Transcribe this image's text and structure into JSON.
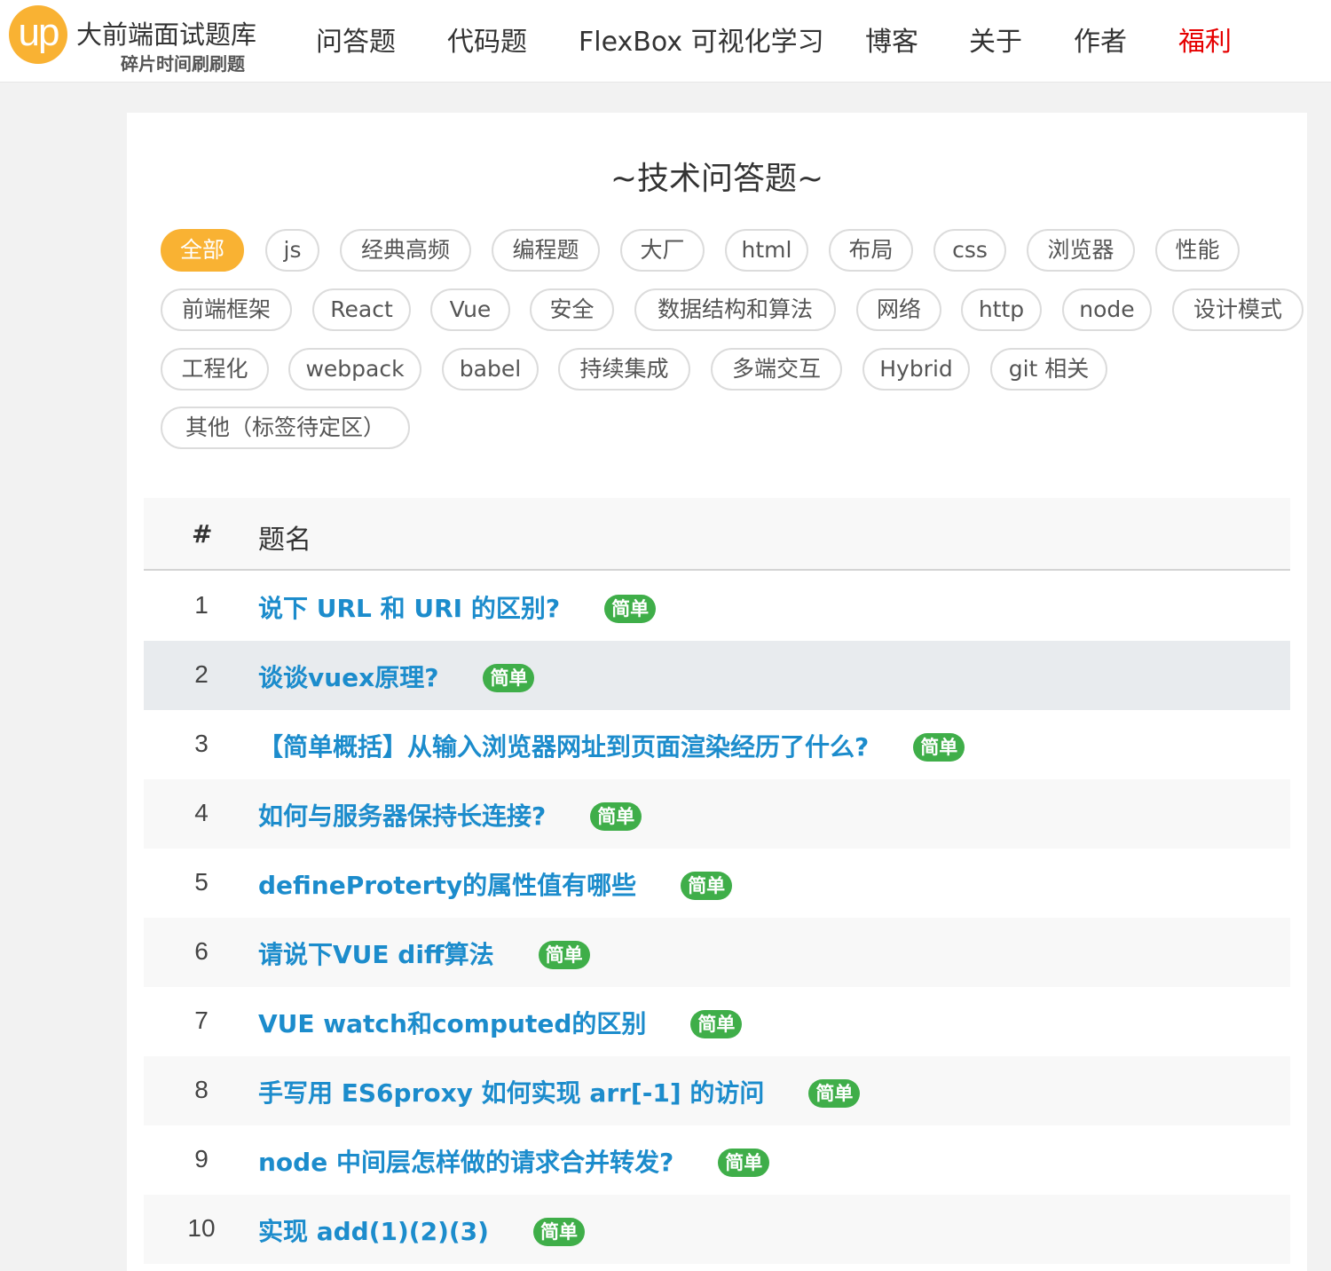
{
  "header": {
    "logo_text": "up",
    "site_name": "大前端面试题库",
    "slogan": "碎片时间刷刷题",
    "nav": [
      {
        "label": "问答题"
      },
      {
        "label": "代码题"
      },
      {
        "label": "FlexBox 可视化学习"
      },
      {
        "label": "博客"
      },
      {
        "label": "关于"
      },
      {
        "label": "作者"
      },
      {
        "label": "福利",
        "color": "#e60000"
      }
    ]
  },
  "main": {
    "title": "~技术问答题~",
    "active_tag": "全部",
    "tags": [
      "全部",
      "js",
      "经典高频",
      "编程题",
      "大厂",
      "html",
      "布局",
      "css",
      "浏览器",
      "性能",
      "前端框架",
      "React",
      "Vue",
      "安全",
      "数据结构和算法",
      "网络",
      "http",
      "node",
      "设计模式",
      "工程化",
      "webpack",
      "babel",
      "持续集成",
      "多端交互",
      "Hybrid",
      "git 相关",
      "其他（标签待定区）"
    ],
    "table": {
      "col_num": "#",
      "col_name": "题名",
      "rows": [
        {
          "num": "1",
          "title": "说下 URL 和 URI 的区别?",
          "badge": "简单"
        },
        {
          "num": "2",
          "title": "谈谈vuex原理?",
          "badge": "简单"
        },
        {
          "num": "3",
          "title": "【简单概括】从输入浏览器网址到页面渲染经历了什么?",
          "badge": "简单"
        },
        {
          "num": "4",
          "title": "如何与服务器保持长连接?",
          "badge": "简单"
        },
        {
          "num": "5",
          "title": "defineProterty的属性值有哪些",
          "badge": "简单"
        },
        {
          "num": "6",
          "title": "请说下VUE diff算法",
          "badge": "简单"
        },
        {
          "num": "7",
          "title": "VUE watch和computed的区别",
          "badge": "简单"
        },
        {
          "num": "8",
          "title": "手写用 ES6proxy 如何实现 arr[-1] 的访问",
          "badge": "简单"
        },
        {
          "num": "9",
          "title": "node 中间层怎样做的请求合并转发?",
          "badge": "简单"
        },
        {
          "num": "10",
          "title": "实现 add(1)(2)(3)",
          "badge": "简单"
        }
      ]
    }
  },
  "colors": {
    "brand": "#f9b233",
    "link": "#1c8ccc",
    "badge": "#3fae49",
    "highlight_nav": "#e60000"
  }
}
